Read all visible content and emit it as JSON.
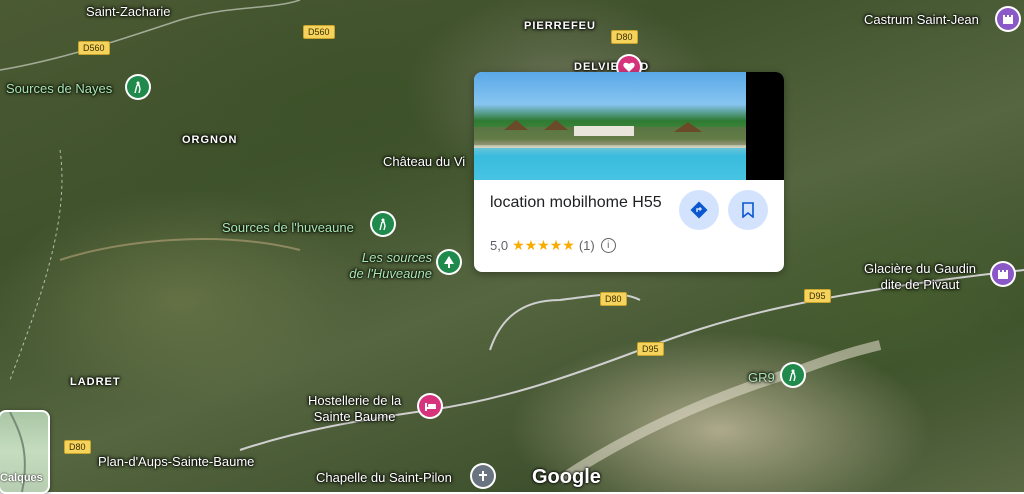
{
  "places": {
    "saint_zacharie": "Saint-Zacharie",
    "pierrefeu": "PIERREFEU",
    "delvie_sud": "DELVIE SUD",
    "castrum": "Castrum Saint-Jean",
    "sources_nayes": "Sources de Nayes",
    "orgnon": "ORGNON",
    "chateau": "Château du Vi",
    "sources_huveaune": "Sources de l'huveaune",
    "les_sources_1": "Les sources",
    "les_sources_2": "de l'Huveaune",
    "glaciere_1": "Glacière du Gaudin",
    "glaciere_2": "dite de Pivaut",
    "ladret": "LADRET",
    "gr9": "GR9",
    "hostellerie_1": "Hostellerie de la",
    "hostellerie_2": "Sainte Baume",
    "plan_aups": "Plan-d'Aups-Sainte-Baume",
    "chapelle": "Chapelle du Saint-Pilon"
  },
  "roads": [
    "D560",
    "D560",
    "D80",
    "D80",
    "D95",
    "D95",
    "D80"
  ],
  "card": {
    "title": "location mobilhome H55",
    "rating": "5,0",
    "stars": "★★★★★",
    "count": "(1)",
    "info": "i"
  },
  "layers_label": "Calques",
  "brand": "Google",
  "icons": {
    "directions": "directions-icon",
    "save": "bookmark-icon",
    "hiking": "hiking-icon",
    "tree": "tree-icon",
    "hotel": "hotel-icon",
    "church": "church-icon",
    "castle": "castle-icon",
    "heart": "heart-icon"
  },
  "colors": {
    "card_button_bg": "#d3e3fd",
    "card_button_fg": "#0b57d0",
    "star": "#f9ab00",
    "road_badge": "#f6d35c"
  }
}
